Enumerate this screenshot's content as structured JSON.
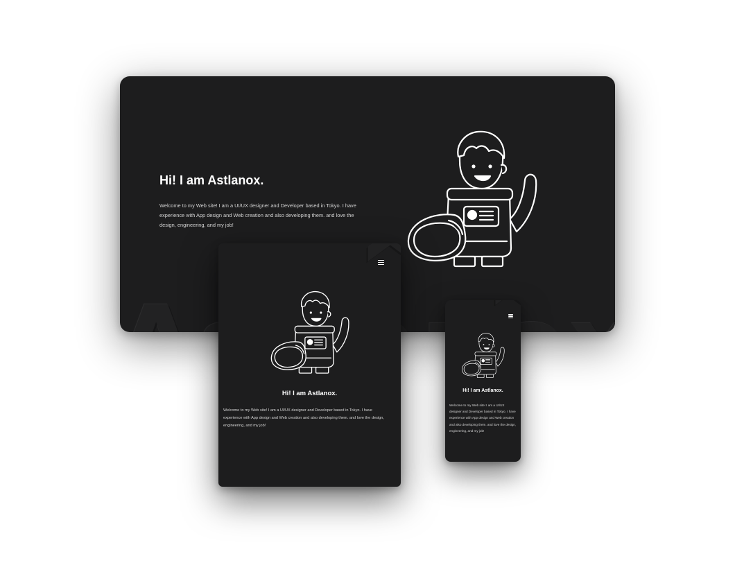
{
  "watermark": "Astlanox",
  "hero": {
    "title": "Hi! I am Astlanox.",
    "description": "Welcome to my Web site! I am a UI/UX designer and Developer based in Tokyo. I have experience with App design and Web creation and also developing them. and love the design, engineering, and my job!"
  },
  "icons": {
    "menu": "hamburger-menu-icon",
    "mascot": "astronaut-mascot-illustration"
  },
  "colors": {
    "background": "#1d1d1e",
    "text": "#ffffff",
    "page": "#ffffff"
  }
}
